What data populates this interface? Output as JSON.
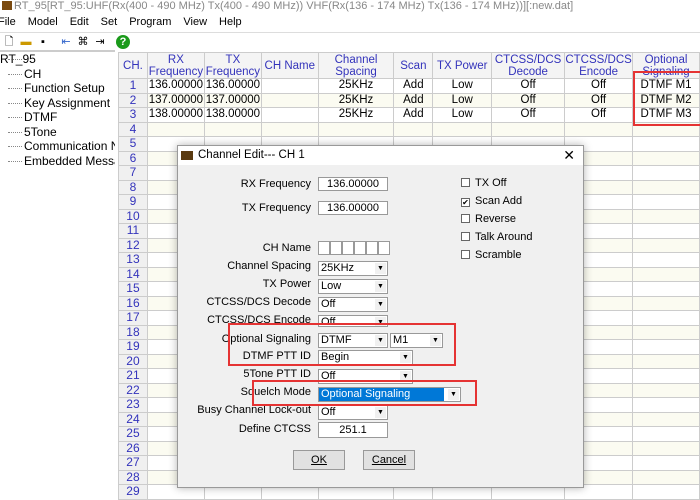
{
  "window": {
    "title": "RT_95[RT_95:UHF(Rx(400 - 490 MHz) Tx(400 - 490 MHz)) VHF(Rx(136 - 174 MHz) Tx(136 - 174 MHz))][:new.dat]"
  },
  "menu": [
    "File",
    "Model",
    "Edit",
    "Set",
    "Program",
    "View",
    "Help"
  ],
  "tree": {
    "root": "RT_95",
    "items": [
      "CH",
      "Function Setup",
      "Key Assignment",
      "DTMF",
      "5Tone",
      "Communication Nc",
      "Embedded Messag"
    ]
  },
  "grid": {
    "headers": [
      "CH.",
      "RX Frequency",
      "TX Frequency",
      "CH Name",
      "Channel Spacing",
      "Scan",
      "TX Power",
      "CTCSS/DCS Decode",
      "CTCSS/DCS Encode",
      "Optional Signaling"
    ],
    "rows": [
      [
        "1",
        "136.00000",
        "136.00000",
        "",
        "25KHz",
        "Add",
        "Low",
        "Off",
        "Off",
        "DTMF M1"
      ],
      [
        "2",
        "137.00000",
        "137.00000",
        "",
        "25KHz",
        "Add",
        "Low",
        "Off",
        "Off",
        "DTMF M2"
      ],
      [
        "3",
        "138.00000",
        "138.00000",
        "",
        "25KHz",
        "Add",
        "Low",
        "Off",
        "Off",
        "DTMF M3"
      ]
    ],
    "empty_rows": [
      "4",
      "5",
      "6",
      "7",
      "8",
      "9",
      "10",
      "11",
      "12",
      "13",
      "14",
      "15",
      "16",
      "17",
      "18",
      "19",
      "20",
      "21",
      "22",
      "23",
      "24",
      "25",
      "26",
      "27",
      "28",
      "29"
    ]
  },
  "dialog": {
    "title": "Channel Edit--- CH 1",
    "rx_label": "RX Frequency",
    "rx_value": "136.00000",
    "tx_label": "TX Frequency",
    "tx_value": "136.00000",
    "name_label": "CH Name",
    "spacing_label": "Channel Spacing",
    "spacing_value": "25KHz",
    "power_label": "TX Power",
    "power_value": "Low",
    "decode_label": "CTCSS/DCS Decode",
    "decode_value": "Off",
    "encode_label": "CTCSS/DCS Encode",
    "encode_value": "Off",
    "optsig_label": "Optional Signaling",
    "optsig_value": "DTMF",
    "optsig_sub_value": "M1",
    "pttid_label": "DTMF PTT ID",
    "pttid_value": "Begin",
    "tone_label": "5Tone PTT ID",
    "tone_value": "Off",
    "squelch_label": "Squelch Mode",
    "squelch_value": "Optional Signaling",
    "busy_label": "Busy Channel Lock-out",
    "busy_value": "Off",
    "ctcss_label": "Define CTCSS",
    "ctcss_value": "251.1",
    "checkboxes": [
      {
        "label": "TX Off",
        "checked": false
      },
      {
        "label": "Scan Add",
        "checked": true
      },
      {
        "label": "Reverse",
        "checked": false
      },
      {
        "label": "Talk Around",
        "checked": false
      },
      {
        "label": "Scramble",
        "checked": false
      }
    ],
    "ok": "OK",
    "cancel": "Cancel"
  }
}
